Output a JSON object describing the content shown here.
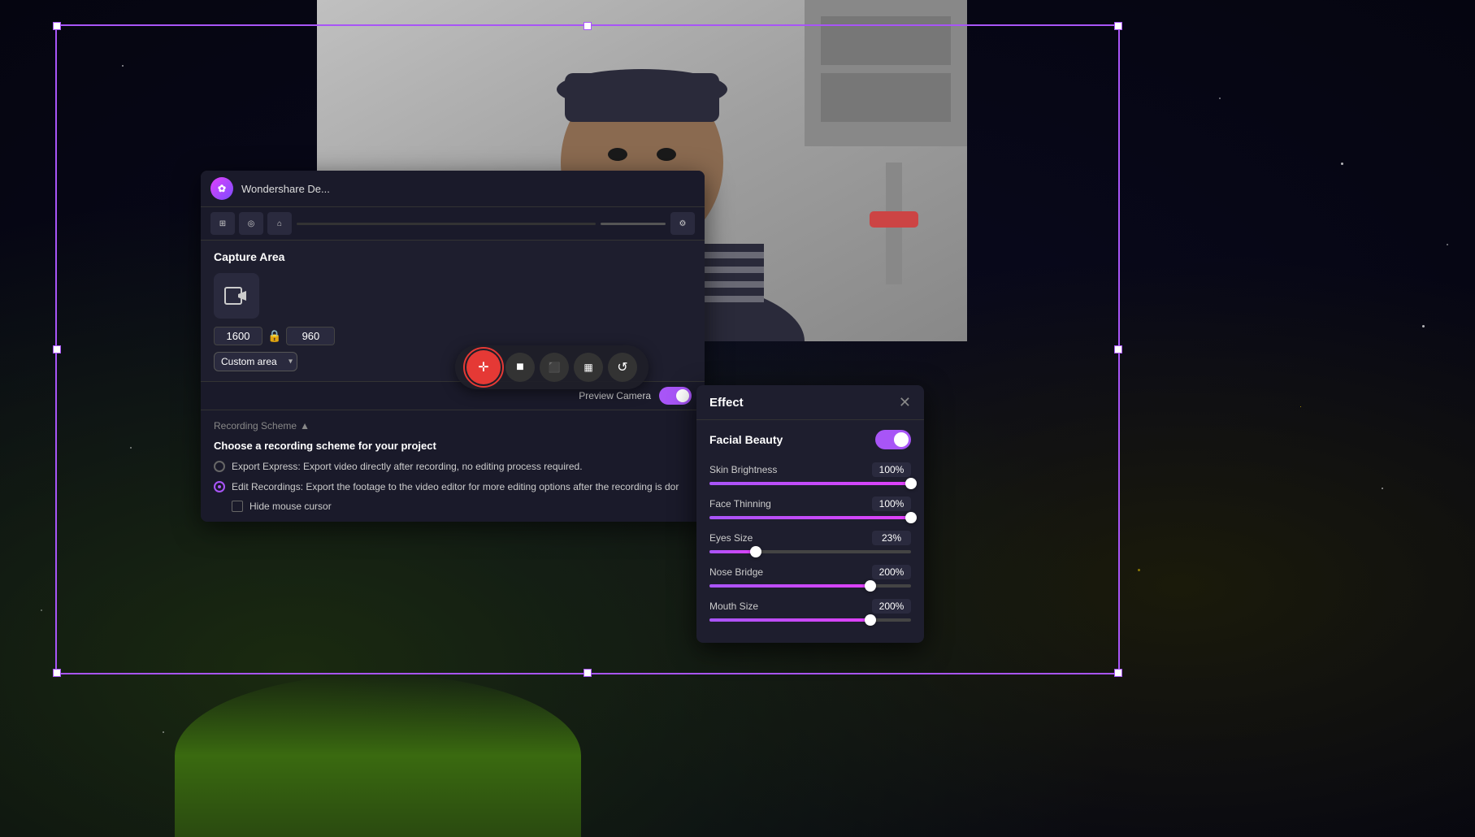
{
  "app": {
    "title": "Wondershare De...",
    "logo_char": "✿"
  },
  "capture_area": {
    "section_title": "Capture Area",
    "width": "1600",
    "height": "960",
    "dropdown_value": "Custom area",
    "dropdown_arrow": "▾"
  },
  "recording_scheme": {
    "label": "Recording Scheme",
    "arrow": "▲",
    "choose_title": "Choose a recording scheme for your project",
    "options": [
      {
        "id": "export-express",
        "label": "Export Express: Export video directly after recording, no editing process required.",
        "selected": false
      },
      {
        "id": "edit-recordings",
        "label": "Edit Recordings: Export the footage to the video editor for more editing options after the recording is dor",
        "selected": true
      }
    ],
    "hide_mouse": {
      "label": "Hide mouse cursor",
      "checked": false
    }
  },
  "preview_camera": {
    "label": "Preview Camera",
    "toggle_on": true
  },
  "effect_panel": {
    "title": "Effect",
    "close_icon": "✕",
    "facial_beauty": {
      "label": "Facial Beauty",
      "enabled": true
    },
    "sliders": [
      {
        "id": "skin-brightness",
        "label": "Skin Brightness",
        "value": "100%",
        "fill_pct": 100,
        "thumb_pct": 100
      },
      {
        "id": "face-thinning",
        "label": "Face Thinning",
        "value": "100%",
        "fill_pct": 100,
        "thumb_pct": 100
      },
      {
        "id": "eyes-size",
        "label": "Eyes Size",
        "value": "23%",
        "fill_pct": 23,
        "thumb_pct": 23
      },
      {
        "id": "nose-bridge",
        "label": "Nose Bridge",
        "value": "200%",
        "fill_pct": 80,
        "thumb_pct": 80
      },
      {
        "id": "mouth-size",
        "label": "Mouth Size",
        "value": "200%",
        "fill_pct": 80,
        "thumb_pct": 80
      }
    ]
  },
  "toolbar": {
    "buttons": [
      {
        "id": "record",
        "icon": "✛",
        "type": "main"
      },
      {
        "id": "stop",
        "icon": "■",
        "type": "normal"
      },
      {
        "id": "camera",
        "icon": "⬛",
        "type": "normal"
      },
      {
        "id": "layout",
        "icon": "▪▪",
        "type": "normal"
      },
      {
        "id": "refresh",
        "icon": "↺",
        "type": "normal"
      }
    ]
  }
}
